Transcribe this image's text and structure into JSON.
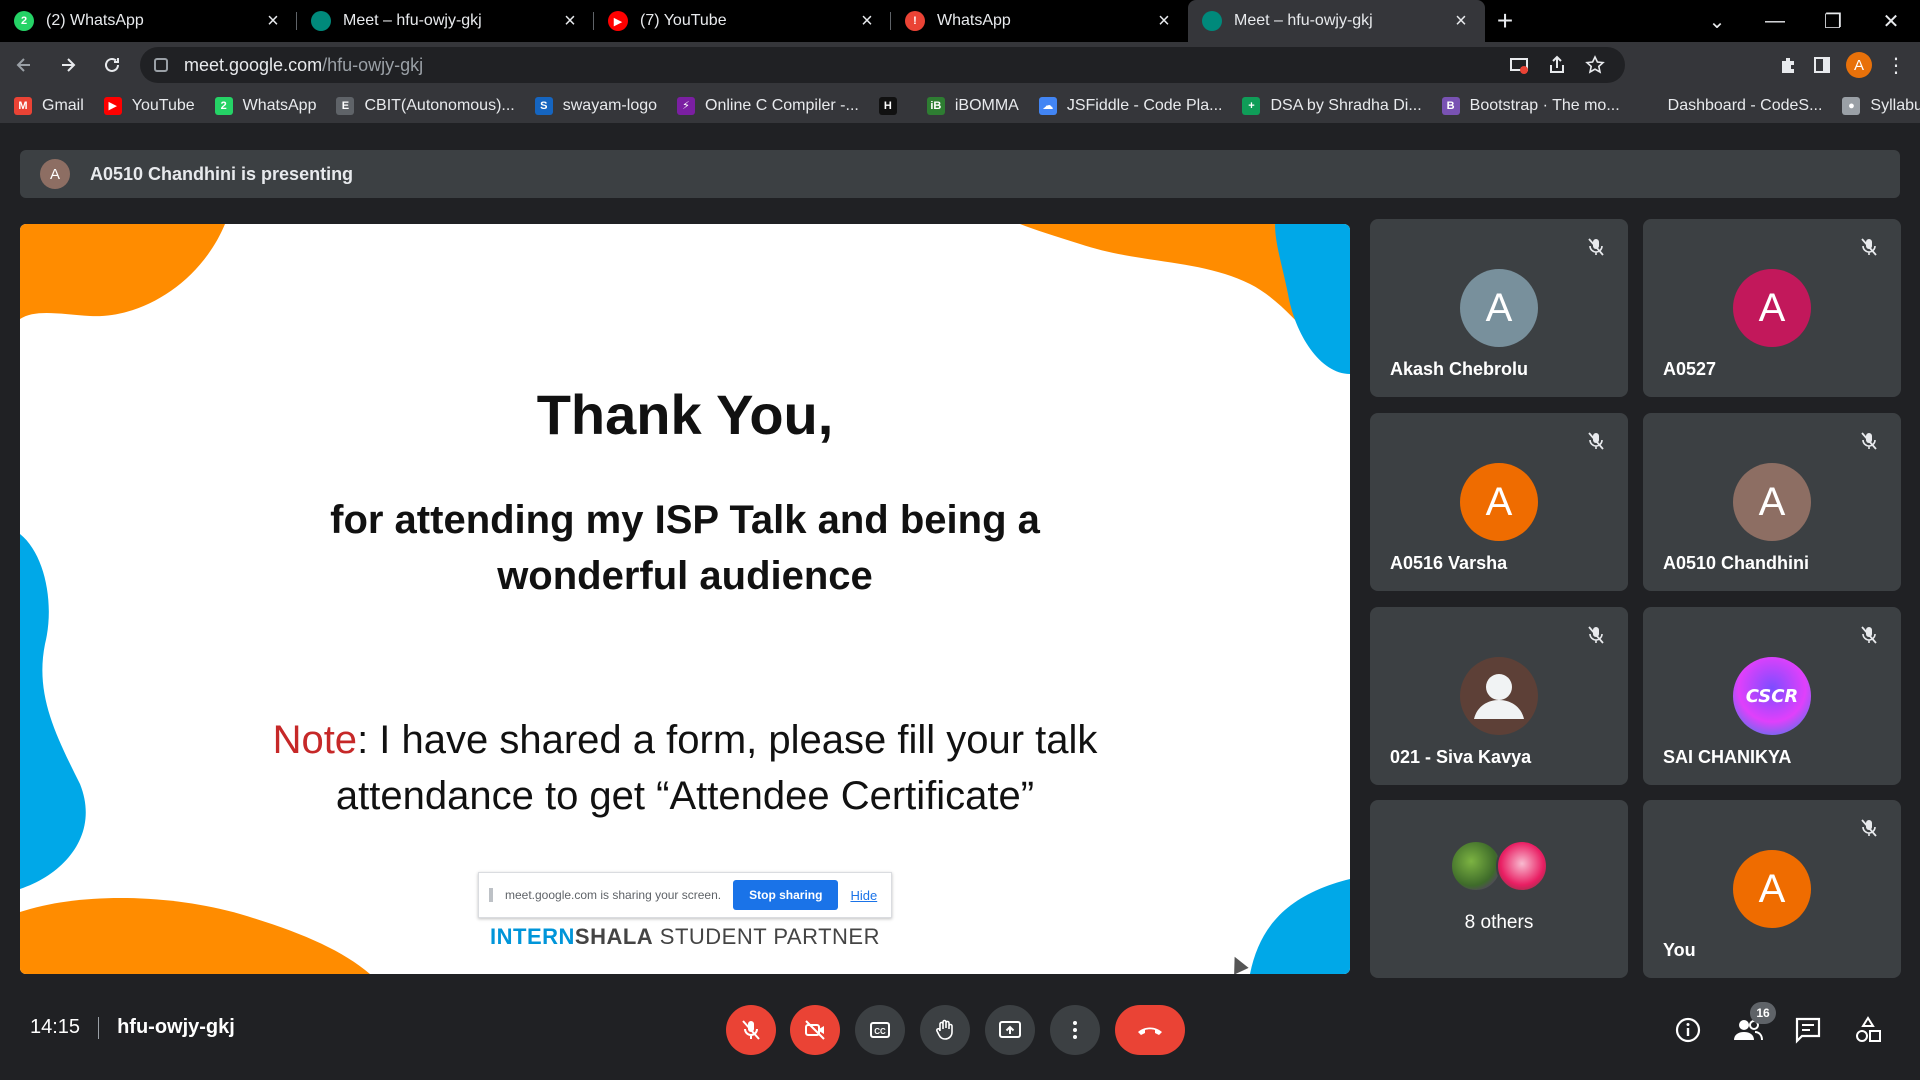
{
  "browser": {
    "tabs": [
      {
        "title": "(2) WhatsApp",
        "icon": "whatsapp-icon",
        "color": "#25d366",
        "glyph": "2"
      },
      {
        "title": "Meet – hfu-owjy-gkj",
        "icon": "meet-icon",
        "color": "#00897b",
        "glyph": ""
      },
      {
        "title": "(7) YouTube",
        "icon": "youtube-icon",
        "color": "#ff0000",
        "glyph": "▶"
      },
      {
        "title": "WhatsApp",
        "icon": "whatsapp-alert-icon",
        "color": "#ea4335",
        "glyph": "!"
      },
      {
        "title": "Meet – hfu-owjy-gkj",
        "icon": "meet-icon",
        "color": "#00897b",
        "glyph": ""
      }
    ],
    "active_tab": 4,
    "new_tab_glyph": "+",
    "window_controls": {
      "dropdown": "⌄",
      "minimize": "—",
      "restore": "❐",
      "close": "✕"
    },
    "url_host": "meet.google.com",
    "url_path": "/hfu-owjy-gkj",
    "profile_initial": "A",
    "bookmarks": [
      {
        "label": "Gmail",
        "color": "#ea4335",
        "glyph": "M"
      },
      {
        "label": "YouTube",
        "color": "#ff0000",
        "glyph": "▶"
      },
      {
        "label": "WhatsApp",
        "color": "#25d366",
        "glyph": "2"
      },
      {
        "label": "CBIT(Autonomous)...",
        "color": "#5f6368",
        "glyph": "E"
      },
      {
        "label": "swayam-logo",
        "color": "#1565c0",
        "glyph": "S"
      },
      {
        "label": "Online C Compiler -...",
        "color": "#7b1fa2",
        "glyph": "⚡"
      },
      {
        "label": "",
        "color": "#111111",
        "glyph": "H"
      },
      {
        "label": "iBOMMA",
        "color": "#2e7d32",
        "glyph": "iB"
      },
      {
        "label": "JSFiddle - Code Pla...",
        "color": "#4285f4",
        "glyph": "☁"
      },
      {
        "label": "DSA by Shradha Di...",
        "color": "#0f9d58",
        "glyph": "+"
      },
      {
        "label": "Bootstrap · The mo...",
        "color": "#7952b3",
        "glyph": "B"
      },
      {
        "label": "Dashboard - CodeS...",
        "color": "#35363a",
        "glyph": ""
      },
      {
        "label": "Syllabus",
        "color": "#9aa0a6",
        "glyph": "●"
      }
    ]
  },
  "meet": {
    "presenter_initial": "A",
    "presenting_text": "A0510 Chandhini is presenting",
    "slide": {
      "title": "Thank You,",
      "subtitle_line1": "for attending my ISP Talk and being a",
      "subtitle_line2": "wonderful audience",
      "note_label": "Note",
      "note_text_1": ": I have shared a form, please fill your talk",
      "note_text_2": "attendance to get “Attendee Certificate”",
      "share_text": "meet.google.com is sharing your screen.",
      "stop_sharing": "Stop sharing",
      "hide": "Hide",
      "brand_intern": "INTERN",
      "brand_shala": "SHALA",
      "brand_rest": " STUDENT PARTNER"
    },
    "participants": [
      {
        "name": "Akash Chebrolu",
        "initial": "A",
        "color": "#78909c",
        "muted": true
      },
      {
        "name": "A0527",
        "initial": "A",
        "color": "#c2185b",
        "muted": true
      },
      {
        "name": "A0516 Varsha",
        "initial": "A",
        "color": "#ef6c00",
        "muted": true
      },
      {
        "name": "A0510 Chandhini",
        "initial": "A",
        "color": "#8d6e63",
        "muted": true
      },
      {
        "name": "021 - Siva Kavya",
        "initial": "",
        "color": "#5d4037",
        "muted": true
      },
      {
        "name": "SAI CHANIKYA",
        "initial": "",
        "color": "#e040fb",
        "muted": true
      },
      {
        "name": "You",
        "initial": "A",
        "color": "#ef6c00",
        "muted": true
      }
    ],
    "others_label": "8 others",
    "time": "14:15",
    "meeting_code": "hfu-owjy-gkj",
    "participant_count": "16",
    "colors": {
      "danger": "#ea4335",
      "tile": "#3c4043",
      "accent_blue": "#00a8e8",
      "accent_orange": "#ff8c00"
    }
  }
}
